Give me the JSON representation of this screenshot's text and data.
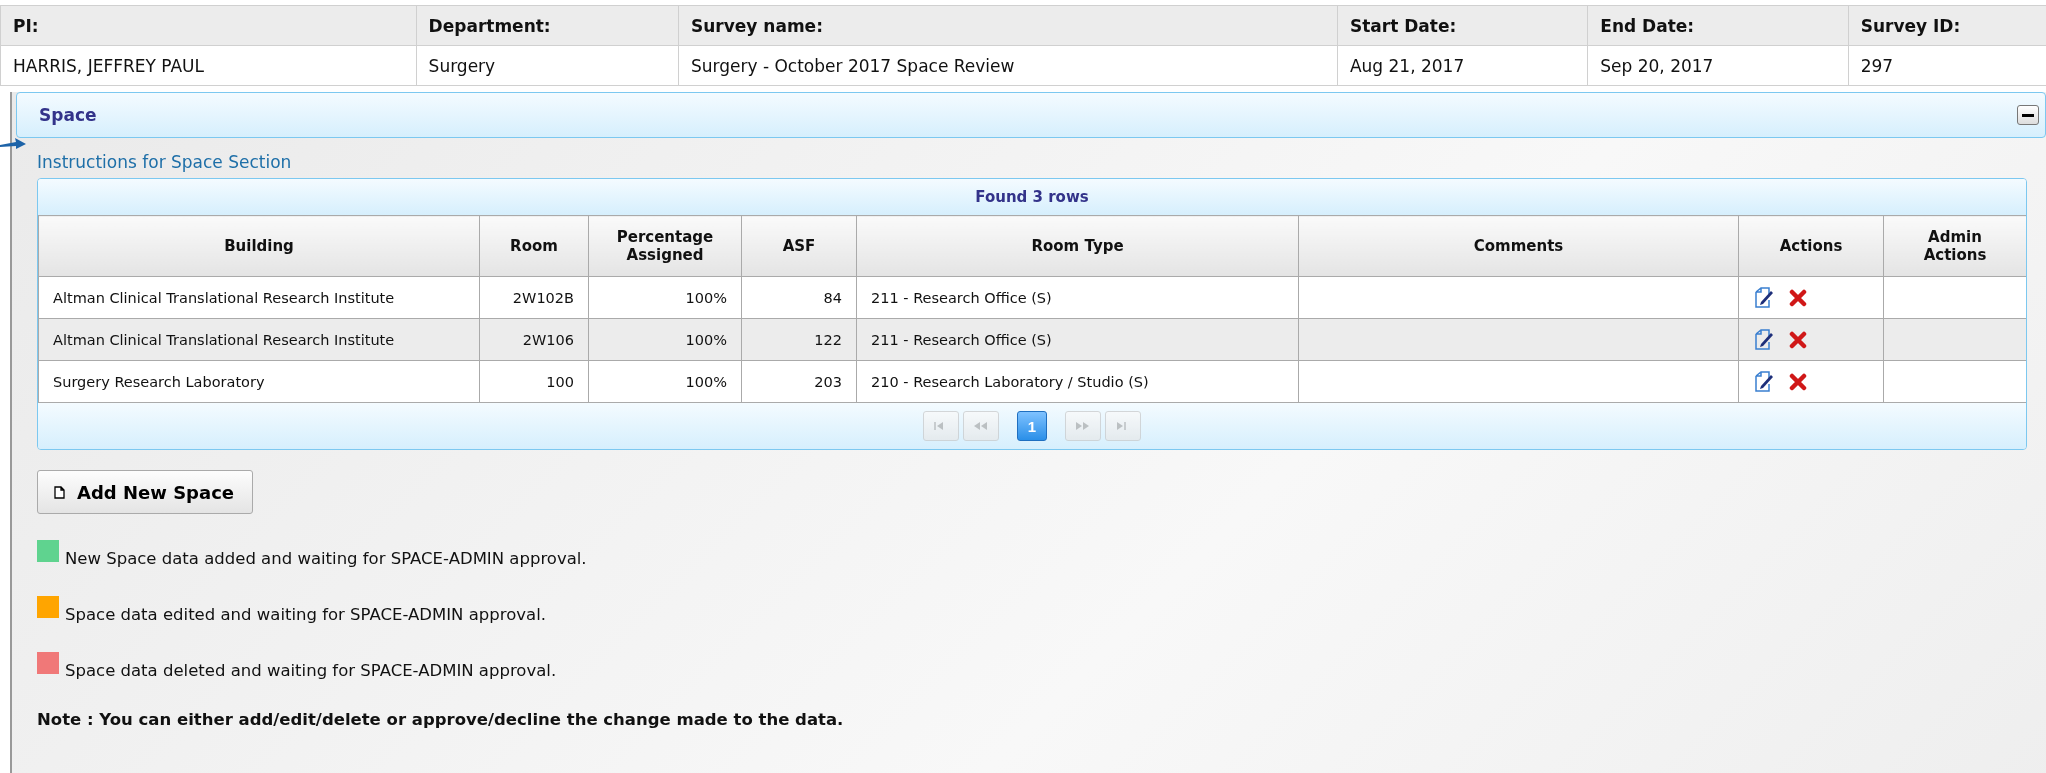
{
  "summary": {
    "columns": [
      "PI:",
      "Department:",
      "Survey name:",
      "Start Date:",
      "End Date:",
      "Survey ID:"
    ],
    "values": [
      "HARRIS, JEFFREY PAUL",
      "Surgery",
      "Surgery - October 2017 Space Review",
      "Aug 21, 2017",
      "Sep 20, 2017",
      "297"
    ]
  },
  "section": {
    "title": "Space",
    "expanded": true,
    "instructions_link": "Instructions for Space Section",
    "grid": {
      "caption": "Found 3 rows",
      "columns": [
        "Building",
        "Room",
        "Percentage Assigned",
        "ASF",
        "Room Type",
        "Comments",
        "Actions",
        "Admin Actions"
      ],
      "rows": [
        {
          "building": "Altman Clinical Translational Research Institute",
          "room": "2W102B",
          "percentage": "100%",
          "asf": "84",
          "room_type": "211 - Research Office (S)",
          "highlighted": false
        },
        {
          "building": "Altman Clinical Translational Research Institute",
          "room": "2W106",
          "percentage": "100%",
          "asf": "122",
          "room_type": "211 - Research Office (S)",
          "highlighted": true
        },
        {
          "building": "Surgery Research Laboratory",
          "room": "100",
          "percentage": "100%",
          "asf": "203",
          "room_type": "210 - Research Laboratory / Studio (S)",
          "highlighted": false
        }
      ],
      "pager": [
        {
          "kind": "first",
          "disabled": true
        },
        {
          "kind": "prev",
          "disabled": true
        },
        {
          "kind": "page",
          "label": "1",
          "selected": true,
          "disabled": false
        },
        {
          "kind": "next",
          "disabled": true
        },
        {
          "kind": "last",
          "disabled": true
        }
      ]
    },
    "add_button": "Add New Space",
    "legend": [
      {
        "color": "#5fd38f",
        "text": "New Space data added and waiting for SPACE-ADMIN approval."
      },
      {
        "color": "#ffa500",
        "text": "Space data edited and waiting for SPACE-ADMIN approval."
      },
      {
        "color": "#f07878",
        "text": "Space data deleted and waiting for SPACE-ADMIN approval."
      }
    ],
    "note": "Note : You can either add/edit/delete or approve/decline the change made to the data."
  }
}
